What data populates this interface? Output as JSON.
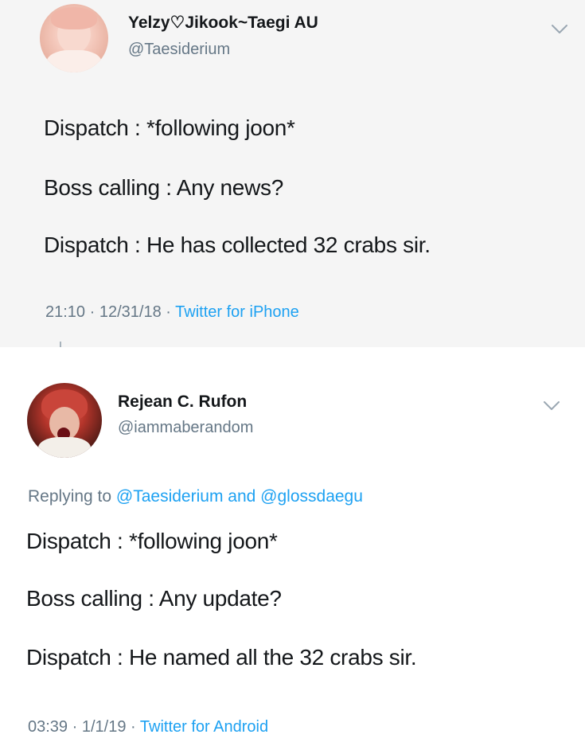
{
  "tweets": [
    {
      "display_name": "Yelzy♡Jikook~Taegi AU",
      "handle": "@Taesiderium",
      "avatar_icon": "profile-avatar",
      "menu_icon": "chevron-down-icon",
      "lines": [
        "Dispatch : *following joon*",
        "Boss calling : Any news?",
        "Dispatch : He has collected 32 crabs sir."
      ],
      "time": "21:10",
      "date": "12/31/18",
      "source": "Twitter for iPhone"
    },
    {
      "display_name": "Rejean C. Rufon",
      "handle": "@iammaberandom",
      "avatar_icon": "profile-avatar",
      "menu_icon": "chevron-down-icon",
      "replying_prefix": "Replying to",
      "replying_mention_1": "@Taesiderium",
      "replying_and": "and",
      "replying_mention_2": "@glossdaegu",
      "lines": [
        "Dispatch : *following joon*",
        "Boss calling : Any update?",
        "Dispatch : He named all the 32 crabs sir."
      ],
      "time": "03:39",
      "date": "1/1/19",
      "source": "Twitter for Android"
    }
  ],
  "meta_separator": "·",
  "colors": {
    "text": "#14171a",
    "secondary": "#657786",
    "link": "#1da1f2",
    "first_tweet_bg": "#f5f5f5"
  }
}
